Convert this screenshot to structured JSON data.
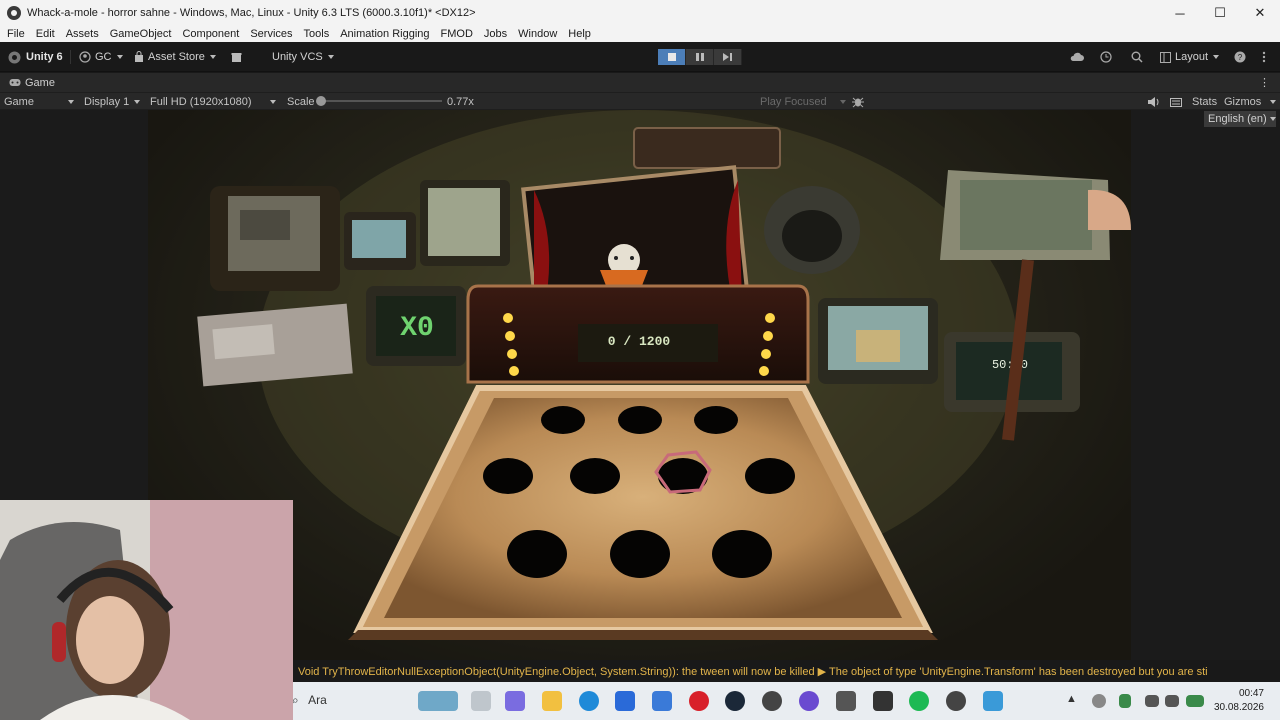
{
  "window": {
    "title": "Whack-a-mole - horror sahne - Windows, Mac, Linux - Unity 6.3 LTS (6000.3.10f1)* <DX12>",
    "minimize": "─",
    "maximize": "☐",
    "close": "✕"
  },
  "menu": [
    "File",
    "Edit",
    "Assets",
    "GameObject",
    "Component",
    "Services",
    "Tools",
    "Animation Rigging",
    "FMOD",
    "Jobs",
    "Window",
    "Help"
  ],
  "toolbar": {
    "account": "Unity 6",
    "gc": "GC",
    "asset_store": "Asset Store",
    "vcs": "Unity VCS",
    "layout": "Layout"
  },
  "tab": {
    "label": "Game"
  },
  "gamebar": {
    "mode": "Game",
    "display": "Display 1",
    "resolution": "Full HD (1920x1080)",
    "scale_label": "Scale",
    "scale_value": "0.77x",
    "play_focused": "Play Focused",
    "stats": "Stats",
    "gizmos": "Gizmos"
  },
  "language": "English (en)",
  "game": {
    "score": "0 / 1200",
    "multiplier": "X0",
    "timer": "50:00"
  },
  "console": {
    "message": "Void TryThrowEditorNullExceptionObject(UnityEngine.Object, System.String)): the tween will now be killed ▶ The object of type 'UnityEngine.Transform' has been destroyed but you are sti"
  },
  "taskbar": {
    "search": "Ara",
    "time": "00:47",
    "date": "30.08.2026"
  },
  "colors": {
    "accent": "#4c7eb8",
    "warning": "#e2b44a",
    "score_green": "#6fd36f"
  }
}
